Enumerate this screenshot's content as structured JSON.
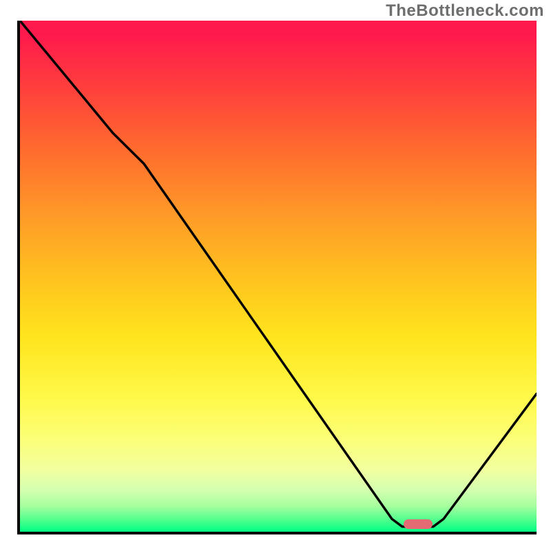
{
  "watermark": "TheBottleneck.com",
  "chart_data": {
    "type": "line",
    "title": "",
    "xlabel": "",
    "ylabel": "",
    "xlim": [
      0,
      100
    ],
    "ylim": [
      0,
      100
    ],
    "grid": false,
    "series": [
      {
        "name": "curve",
        "points": [
          {
            "x": 0,
            "y": 100
          },
          {
            "x": 18,
            "y": 78
          },
          {
            "x": 24,
            "y": 72
          },
          {
            "x": 72,
            "y": 2.5
          },
          {
            "x": 74,
            "y": 1
          },
          {
            "x": 80,
            "y": 1
          },
          {
            "x": 82,
            "y": 2.5
          },
          {
            "x": 100,
            "y": 27
          }
        ]
      }
    ],
    "marker": {
      "x": 77,
      "y": 1.5
    },
    "colors": {
      "curve": "#000000",
      "marker": "#e46a73",
      "axis": "#000000",
      "gradient_top": "#ff1a4d",
      "gradient_mid": "#ffe51d",
      "gradient_bottom": "#00ff84"
    }
  }
}
